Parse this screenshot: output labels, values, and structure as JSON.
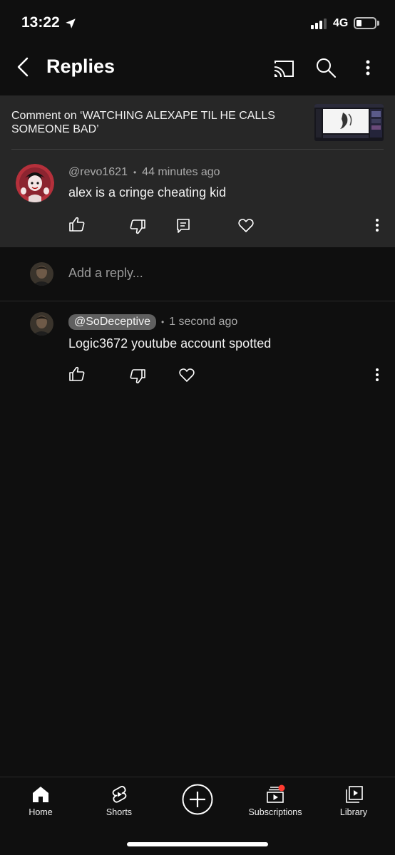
{
  "status_bar": {
    "time": "13:22",
    "network": "4G"
  },
  "header": {
    "title": "Replies",
    "icons": [
      "back-icon",
      "cast-icon",
      "search-icon",
      "more-icon"
    ]
  },
  "context": {
    "text": "Comment on ‘WATCHING ALEXAPE TIL HE CALLS SOMEONE BAD’"
  },
  "parent_comment": {
    "author": "@revo1621",
    "separator": "•",
    "time": "44 minutes ago",
    "text": "alex is a cringe cheating kid"
  },
  "reply_input": {
    "placeholder": "Add a reply..."
  },
  "reply": {
    "author": "@SoDeceptive",
    "separator": "•",
    "time": "1 second ago",
    "text": "Logic3672 youtube account spotted"
  },
  "bottom_nav": {
    "home": "Home",
    "shorts": "Shorts",
    "subscriptions": "Subscriptions",
    "library": "Library"
  },
  "colors": {
    "background": "#0f0f0f",
    "panel": "#272727",
    "notification_dot": "#ff3b30"
  }
}
